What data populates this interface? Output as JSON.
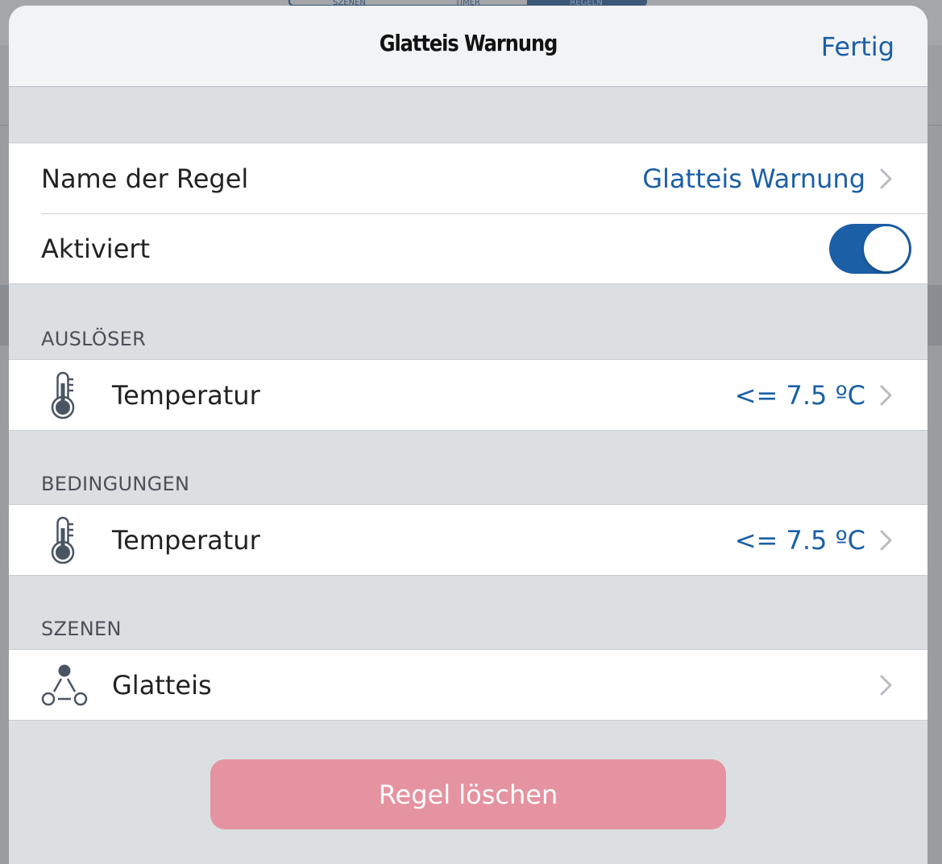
{
  "background_app": {
    "segments": [
      "SZENEN",
      "TIMER",
      "REGELN"
    ],
    "active_segment": "REGELN"
  },
  "modal": {
    "title": "Glatteis Warnung",
    "done_label": "Fertig"
  },
  "rule": {
    "name_label": "Name der Regel",
    "name_value": "Glatteis Warnung",
    "active_label": "Aktiviert",
    "active": true
  },
  "triggers": {
    "header": "AUSLÖSER",
    "items": [
      {
        "icon": "thermometer-icon",
        "label": "Temperatur",
        "value": "<= 7.5 ºC"
      }
    ]
  },
  "conditions": {
    "header": "BEDINGUNGEN",
    "items": [
      {
        "icon": "thermometer-icon",
        "label": "Temperatur",
        "value": "<= 7.5 ºC"
      }
    ]
  },
  "scenes": {
    "header": "SZENEN",
    "items": [
      {
        "icon": "scene-icon",
        "label": "Glatteis"
      }
    ]
  },
  "delete_label": "Regel löschen",
  "colors": {
    "accent": "#1b5fa6",
    "destructive": "#e593a0",
    "group_background": "#dcdfe2"
  }
}
